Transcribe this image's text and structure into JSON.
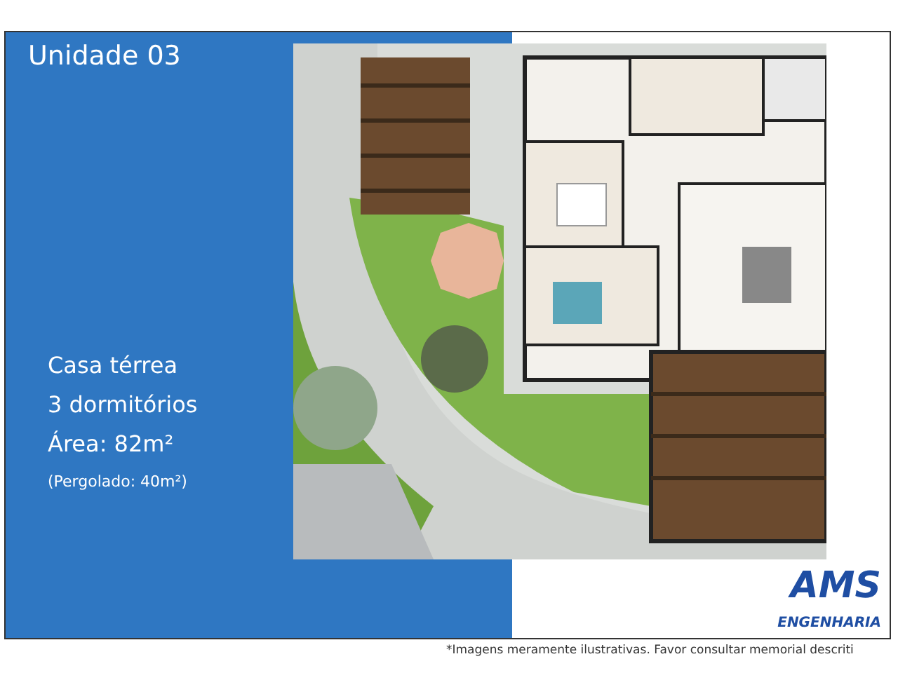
{
  "title": "Unidade 03",
  "specs": [
    {
      "kind": "main",
      "text": "Casa térrea"
    },
    {
      "kind": "main",
      "text": "3 dormitórios"
    },
    {
      "kind": "main",
      "text": "Área: 82m²"
    },
    {
      "kind": "note",
      "text": "(Pergolado: 40m²)"
    }
  ],
  "logo": {
    "name": "AMS",
    "tagline": "ENGENHARIA"
  },
  "footnote": "*Imagens meramente ilustrativas. Favor consultar memorial descriti"
}
